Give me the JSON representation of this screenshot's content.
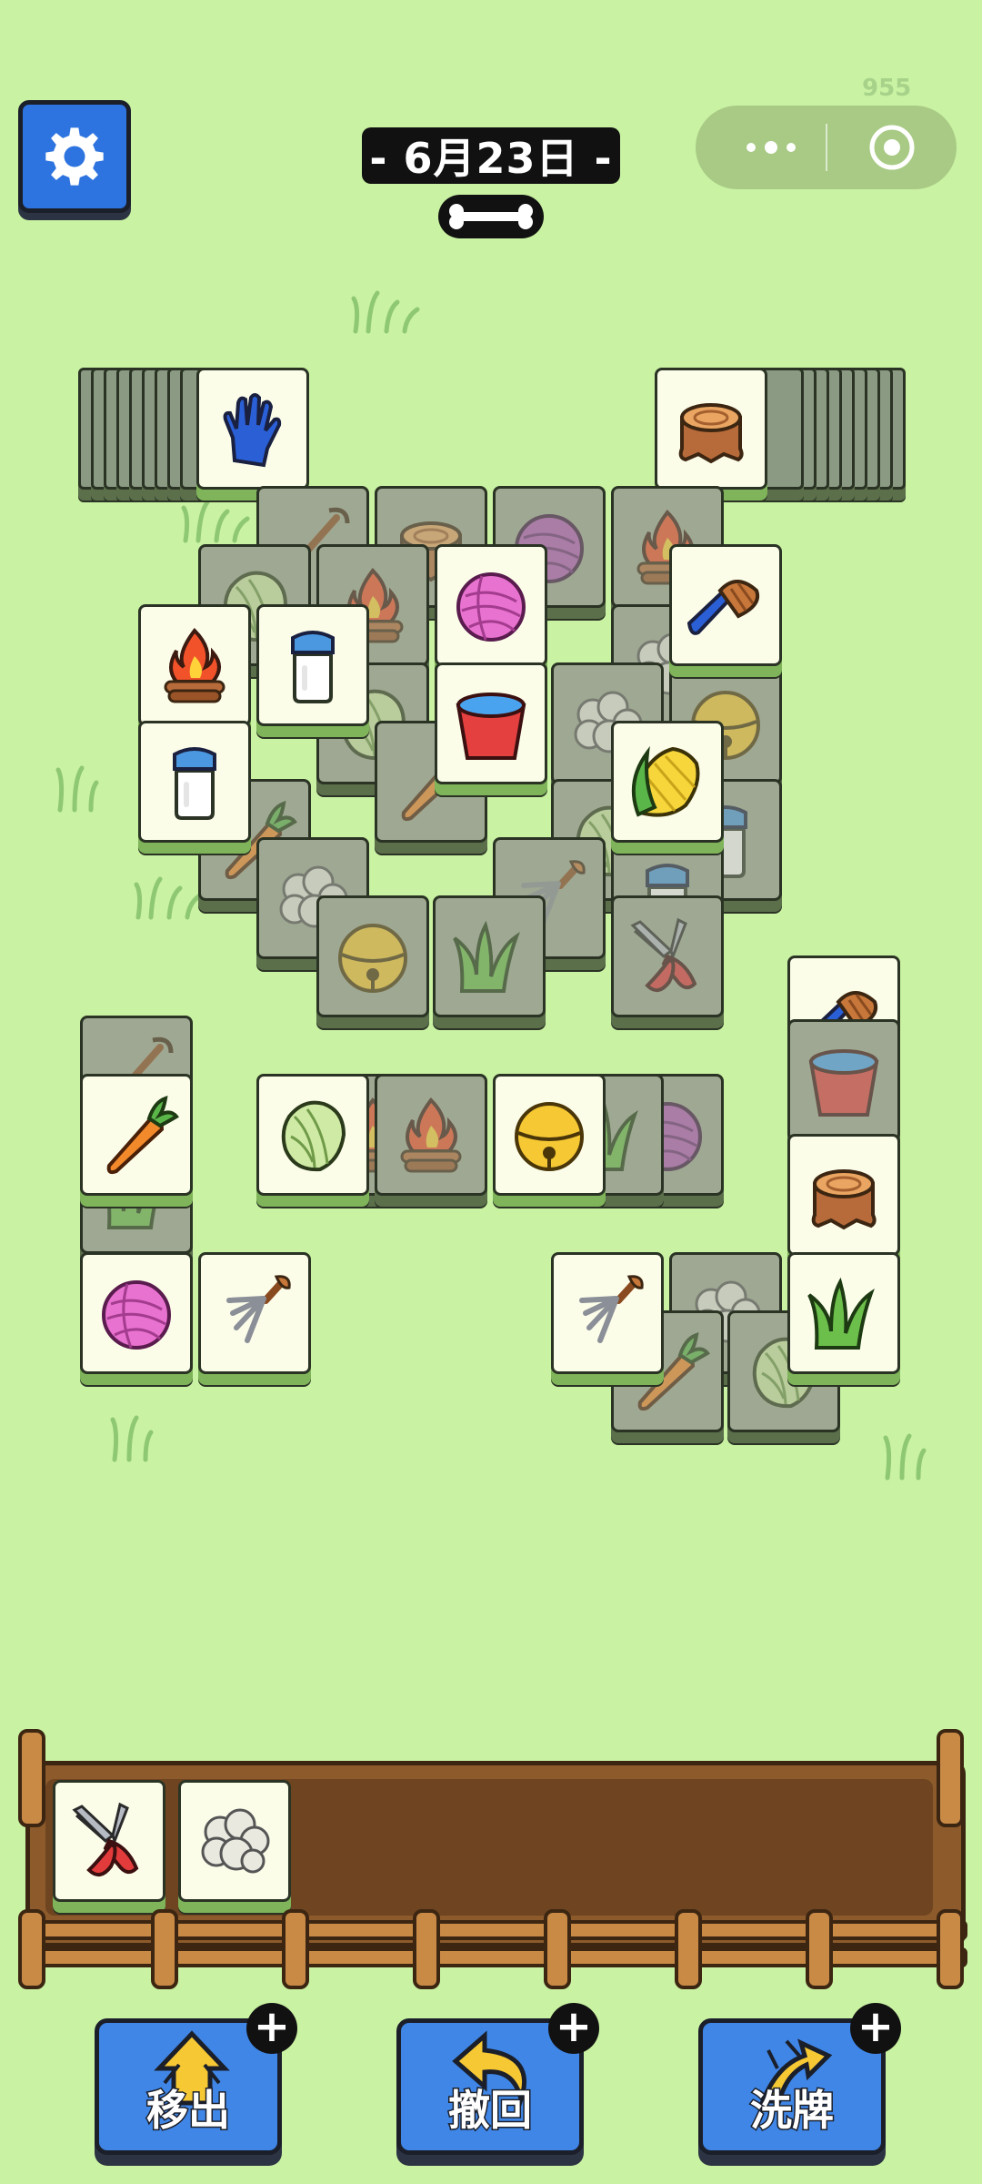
{
  "header": {
    "date_label": "- 6月23日 -",
    "score": "955",
    "settings_icon": "gear-icon",
    "menu_icon": "more-dots-icon",
    "close_icon": "target-circle-icon"
  },
  "board": {
    "left_stack_top": "glove",
    "right_stack_top": "stump",
    "tiles": [
      {
        "id": "t1",
        "icon": "shovel",
        "dim": true
      },
      {
        "id": "t2",
        "icon": "stump",
        "dim": true
      },
      {
        "id": "t3",
        "icon": "purple-yarn",
        "dim": true
      },
      {
        "id": "t4",
        "icon": "campfire",
        "dim": true
      },
      {
        "id": "t5",
        "icon": "cabbage",
        "dim": true
      },
      {
        "id": "t6",
        "icon": "campfire",
        "dim": true
      },
      {
        "id": "t7",
        "icon": "pink-yarn",
        "dim": false
      },
      {
        "id": "t8",
        "icon": "brush",
        "dim": false
      },
      {
        "id": "t9",
        "icon": "campfire",
        "dim": false
      },
      {
        "id": "t10",
        "icon": "milk-bottle",
        "dim": false
      },
      {
        "id": "t11",
        "icon": "bucket",
        "dim": false
      },
      {
        "id": "t12",
        "icon": "wool",
        "dim": true
      },
      {
        "id": "t13",
        "icon": "bell",
        "dim": true
      },
      {
        "id": "t14",
        "icon": "milk-bottle",
        "dim": false
      },
      {
        "id": "t15",
        "icon": "corn",
        "dim": false
      },
      {
        "id": "t16",
        "icon": "carrot",
        "dim": true
      },
      {
        "id": "t17",
        "icon": "cabbage",
        "dim": true
      },
      {
        "id": "t18",
        "icon": "wool",
        "dim": true
      },
      {
        "id": "t19",
        "icon": "pitchfork",
        "dim": true
      },
      {
        "id": "t20",
        "icon": "grass",
        "dim": true
      },
      {
        "id": "t21",
        "icon": "bell",
        "dim": true
      },
      {
        "id": "t22",
        "icon": "shears",
        "dim": true
      },
      {
        "id": "t23",
        "icon": "brush",
        "dim": false
      },
      {
        "id": "t24",
        "icon": "shovel",
        "dim": true
      },
      {
        "id": "t25",
        "icon": "carrot",
        "dim": false
      },
      {
        "id": "t26",
        "icon": "cabbage",
        "dim": false
      },
      {
        "id": "t27",
        "icon": "campfire",
        "dim": true
      },
      {
        "id": "t28",
        "icon": "bell",
        "dim": false
      },
      {
        "id": "t29",
        "icon": "purple-yarn",
        "dim": true
      },
      {
        "id": "t30",
        "icon": "stump",
        "dim": false
      },
      {
        "id": "t31",
        "icon": "pink-yarn",
        "dim": false
      },
      {
        "id": "t32",
        "icon": "pitchfork",
        "dim": false
      },
      {
        "id": "t33",
        "icon": "pitchfork",
        "dim": false
      },
      {
        "id": "t34",
        "icon": "grass",
        "dim": false
      },
      {
        "id": "t35",
        "icon": "carrot",
        "dim": true
      },
      {
        "id": "t36",
        "icon": "cabbage",
        "dim": true
      }
    ]
  },
  "tray": {
    "slots": [
      "shears",
      "wool"
    ]
  },
  "actions": [
    {
      "label": "移出",
      "icon": "move-out-icon"
    },
    {
      "label": "撤回",
      "icon": "undo-icon"
    },
    {
      "label": "洗牌",
      "icon": "shuffle-icon"
    }
  ],
  "plus_symbol": "+"
}
